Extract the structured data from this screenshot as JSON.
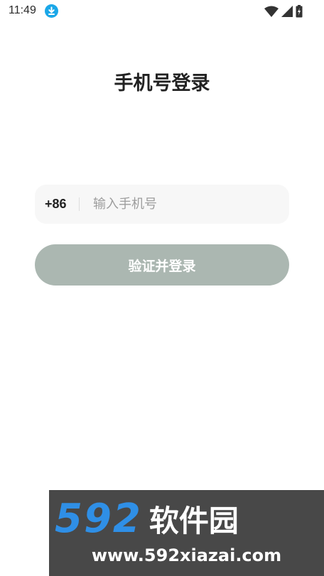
{
  "status_bar": {
    "time": "11:49",
    "icons": [
      "download-icon",
      "wifi-icon",
      "signal-icon",
      "battery-charging-icon"
    ],
    "download_color": "#1aa7e8"
  },
  "page": {
    "title": "手机号登录"
  },
  "phone_field": {
    "country_code": "+86",
    "value": "",
    "placeholder": "输入手机号"
  },
  "login_button": {
    "label": "验证并登录",
    "color": "#abb7b1"
  },
  "watermark": {
    "number": "592",
    "brand": "软件园",
    "url": "www.592xiazai.com"
  }
}
